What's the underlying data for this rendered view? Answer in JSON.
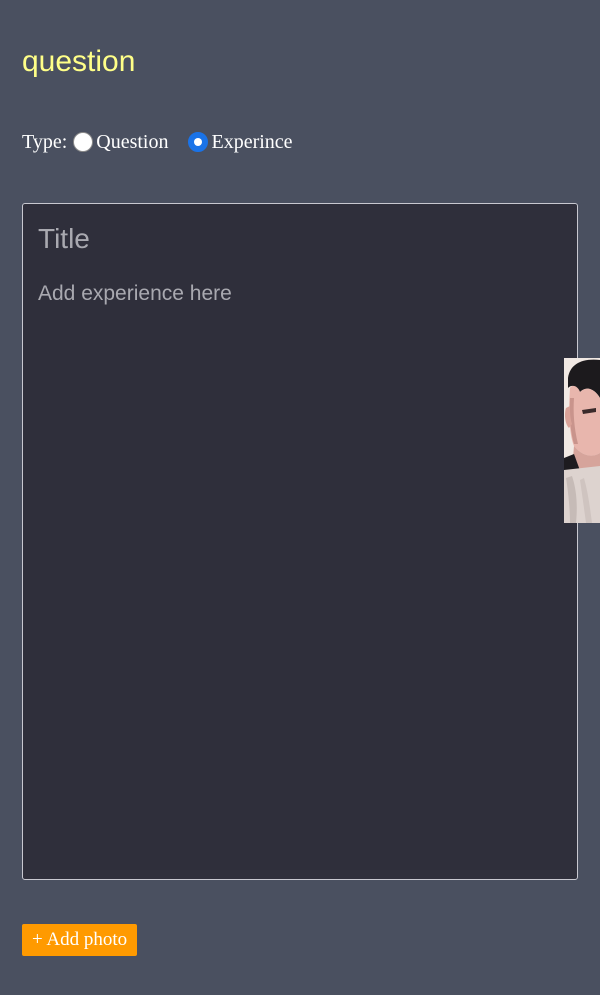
{
  "heading": "question",
  "type_selector": {
    "label": "Type:",
    "options": [
      {
        "label": "Question",
        "selected": false
      },
      {
        "label": "Experince",
        "selected": true
      }
    ]
  },
  "editor": {
    "title_placeholder": "Title",
    "body_placeholder": "Add experience here"
  },
  "add_photo_label": "+ Add photo",
  "colors": {
    "background": "#4a5060",
    "heading": "#ffff88",
    "editor_background": "#2f2f3b",
    "radio_selected": "#1a73e8",
    "add_photo_button": "#ff9a00"
  }
}
